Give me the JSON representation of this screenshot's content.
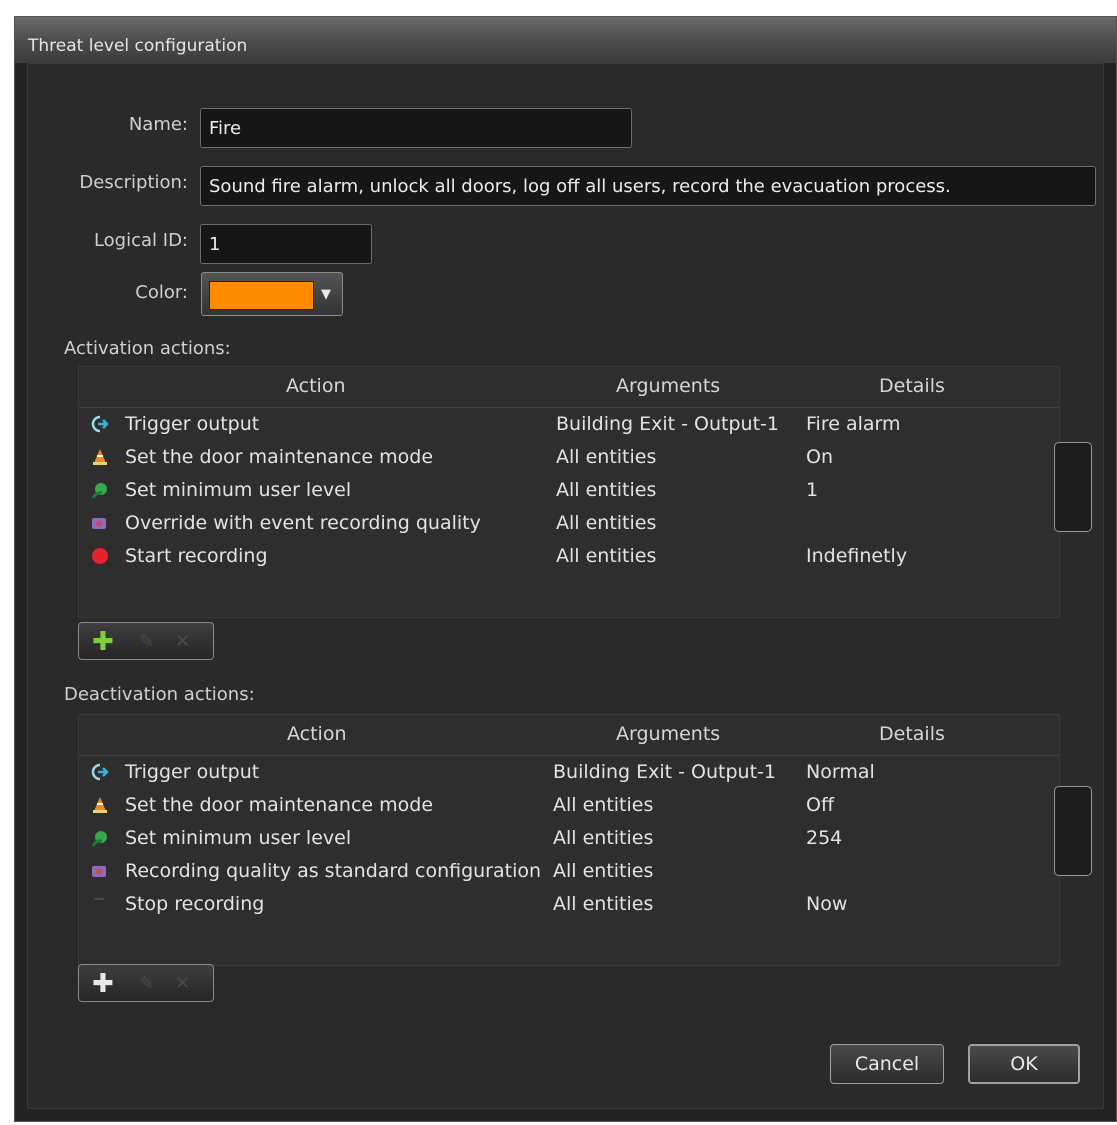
{
  "window": {
    "title": "Threat level configuration"
  },
  "form": {
    "name_label": "Name:",
    "name_value": "Fire",
    "description_label": "Description:",
    "description_value": "Sound fire alarm, unlock all doors, log off all users, record the evacuation process.",
    "logical_id_label": "Logical ID:",
    "logical_id_value": "1",
    "color_label": "Color:",
    "color_value": "#ff8c00"
  },
  "activation": {
    "label": "Activation actions:",
    "columns": [
      "Action",
      "Arguments",
      "Details"
    ],
    "rows": [
      {
        "icon": "output-icon",
        "action": "Trigger output",
        "arguments": "Building Exit - Output-1",
        "details": "Fire alarm"
      },
      {
        "icon": "door-maintenance-icon",
        "action": "Set the door maintenance mode",
        "arguments": "All entities",
        "details": "On"
      },
      {
        "icon": "user-level-icon",
        "action": "Set minimum user level",
        "arguments": "All entities",
        "details": "1"
      },
      {
        "icon": "recording-quality-icon",
        "action": "Override with event recording quality",
        "arguments": "All entities",
        "details": ""
      },
      {
        "icon": "record-icon",
        "action": "Start recording",
        "arguments": "All entities",
        "details": "Indefinetly"
      }
    ]
  },
  "deactivation": {
    "label": "Deactivation actions:",
    "columns": [
      "Action",
      "Arguments",
      "Details"
    ],
    "rows": [
      {
        "icon": "output-icon",
        "action": "Trigger output",
        "arguments": "Building Exit - Output-1",
        "details": "Normal"
      },
      {
        "icon": "door-maintenance-icon",
        "action": "Set the door maintenance mode",
        "arguments": "All entities",
        "details": "Off"
      },
      {
        "icon": "user-level-icon",
        "action": "Set minimum user level",
        "arguments": "All entities",
        "details": "254"
      },
      {
        "icon": "recording-quality-icon",
        "action": "Recording quality as standard configuration",
        "arguments": "All entities",
        "details": ""
      },
      {
        "icon": "stop-recording-icon",
        "action": "Stop recording",
        "arguments": "All entities",
        "details": "Now"
      }
    ]
  },
  "colors": {
    "add_icon": "#7fd03a",
    "add_icon_dim": "#e8e8e8"
  },
  "buttons": {
    "cancel": "Cancel",
    "ok": "OK"
  }
}
